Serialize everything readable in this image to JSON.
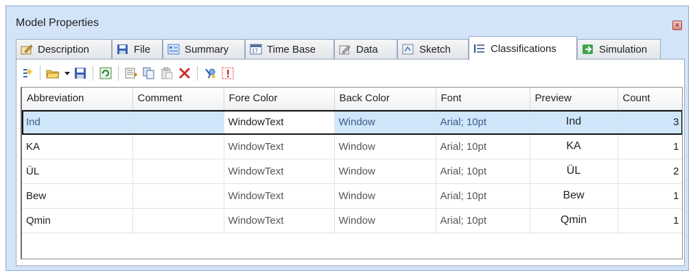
{
  "window": {
    "title": "Model Properties",
    "close_glyph": "×"
  },
  "tabs": [
    {
      "label": "Description",
      "icon": "description-icon"
    },
    {
      "label": "File",
      "icon": "save-disk-icon"
    },
    {
      "label": "Summary",
      "icon": "summary-icon"
    },
    {
      "label": "Time Base",
      "icon": "calendar-icon"
    },
    {
      "label": "Data",
      "icon": "data-edit-icon"
    },
    {
      "label": "Sketch",
      "icon": "sketch-icon"
    },
    {
      "label": "Classifications",
      "icon": "list-icon",
      "active": true
    },
    {
      "label": "Simulation",
      "icon": "play-arrow-icon"
    }
  ],
  "toolbar": {
    "buttons": [
      "new-icon",
      "open-folder-icon",
      "dropdown-arrow-icon",
      "save-icon",
      "refresh-icon",
      "add-row-icon",
      "copy-icon",
      "paste-icon",
      "delete-icon",
      "format-icon",
      "warning-icon"
    ]
  },
  "grid": {
    "columns": [
      "Abbreviation",
      "Comment",
      "Fore Color",
      "Back Color",
      "Font",
      "Preview",
      "Count"
    ],
    "rows": [
      {
        "abbreviation": "Ind",
        "comment": "",
        "fore_color": "WindowText",
        "back_color": "Window",
        "font": "Arial; 10pt",
        "preview": "Ind",
        "count": "3"
      },
      {
        "abbreviation": "KA",
        "comment": "",
        "fore_color": "WindowText",
        "back_color": "Window",
        "font": "Arial; 10pt",
        "preview": "KA",
        "count": "1"
      },
      {
        "abbreviation": "ÜL",
        "comment": "",
        "fore_color": "WindowText",
        "back_color": "Window",
        "font": "Arial; 10pt",
        "preview": "ÜL",
        "count": "2"
      },
      {
        "abbreviation": "Bew",
        "comment": "",
        "fore_color": "WindowText",
        "back_color": "Window",
        "font": "Arial; 10pt",
        "preview": "Bew",
        "count": "1"
      },
      {
        "abbreviation": "Qmin",
        "comment": "",
        "fore_color": "WindowText",
        "back_color": "Window",
        "font": "Arial; 10pt",
        "preview": "Qmin",
        "count": "1"
      }
    ],
    "selected_row": 0
  },
  "colors": {
    "window_bg": "#d3e3f8",
    "selection": "#cfe6fb",
    "delete_red": "#d12a2a"
  }
}
